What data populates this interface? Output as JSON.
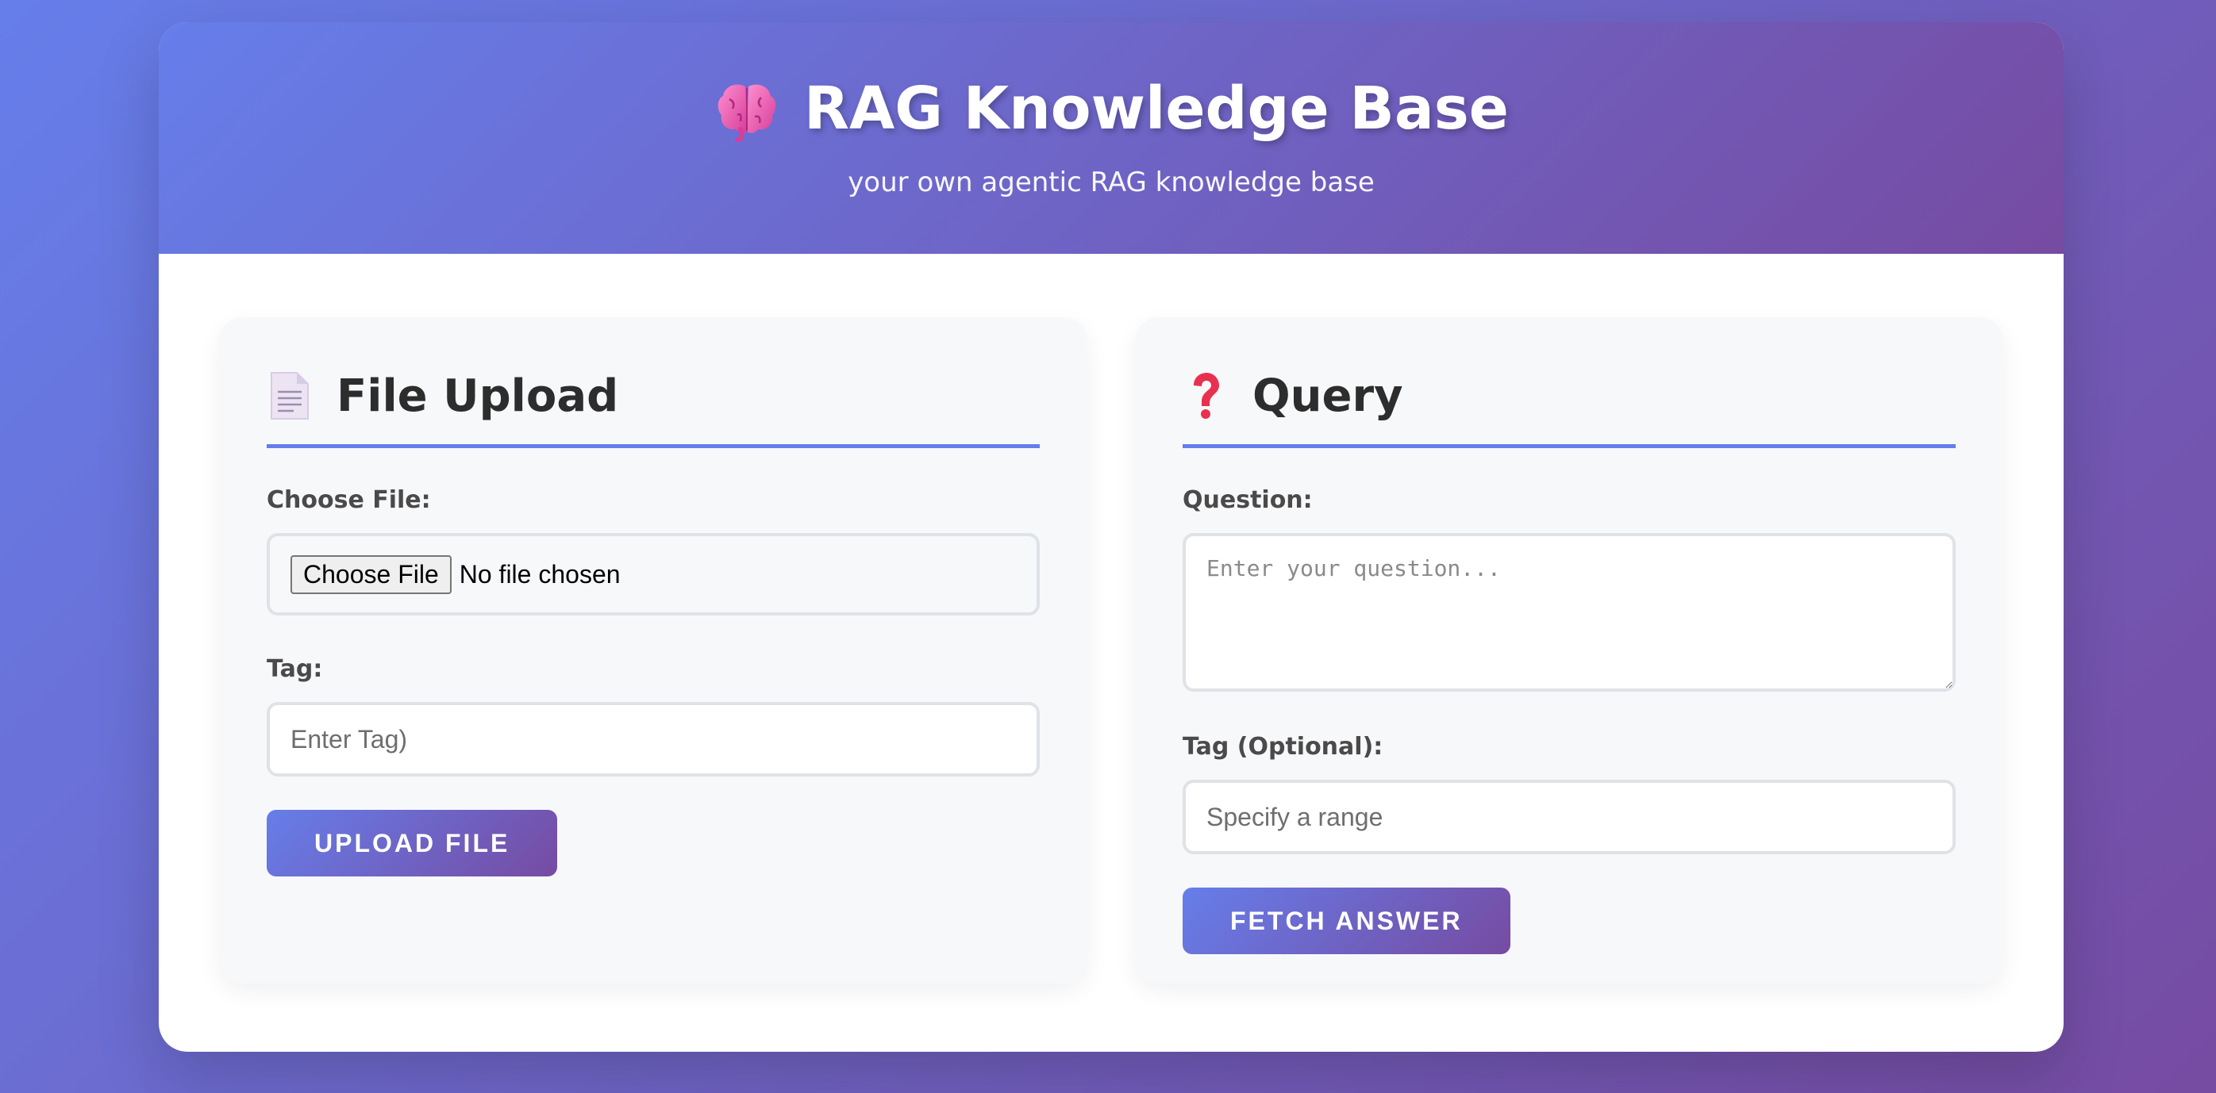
{
  "header": {
    "icon": "brain-icon",
    "title": "RAG Knowledge Base",
    "subtitle": "your own agentic RAG knowledge base"
  },
  "upload_panel": {
    "icon": "document-icon",
    "title": "File Upload",
    "file_label": "Choose File:",
    "file_button": "Choose File",
    "file_status": "No file chosen",
    "tag_label": "Tag:",
    "tag_placeholder": "Enter Tag)",
    "tag_value": "",
    "submit_label": "UPLOAD FILE"
  },
  "query_panel": {
    "icon": "question-mark-icon",
    "title": "Query",
    "question_label": "Question:",
    "question_placeholder": "Enter your question...",
    "question_value": "",
    "tag_label": "Tag (Optional):",
    "tag_placeholder": "Specify a range",
    "tag_value": "",
    "submit_label": "FETCH ANSWER"
  },
  "colors": {
    "gradient_start": "#667eea",
    "gradient_end": "#764ba2",
    "accent_line": "#667eea",
    "panel_bg": "#f7f8fa"
  }
}
